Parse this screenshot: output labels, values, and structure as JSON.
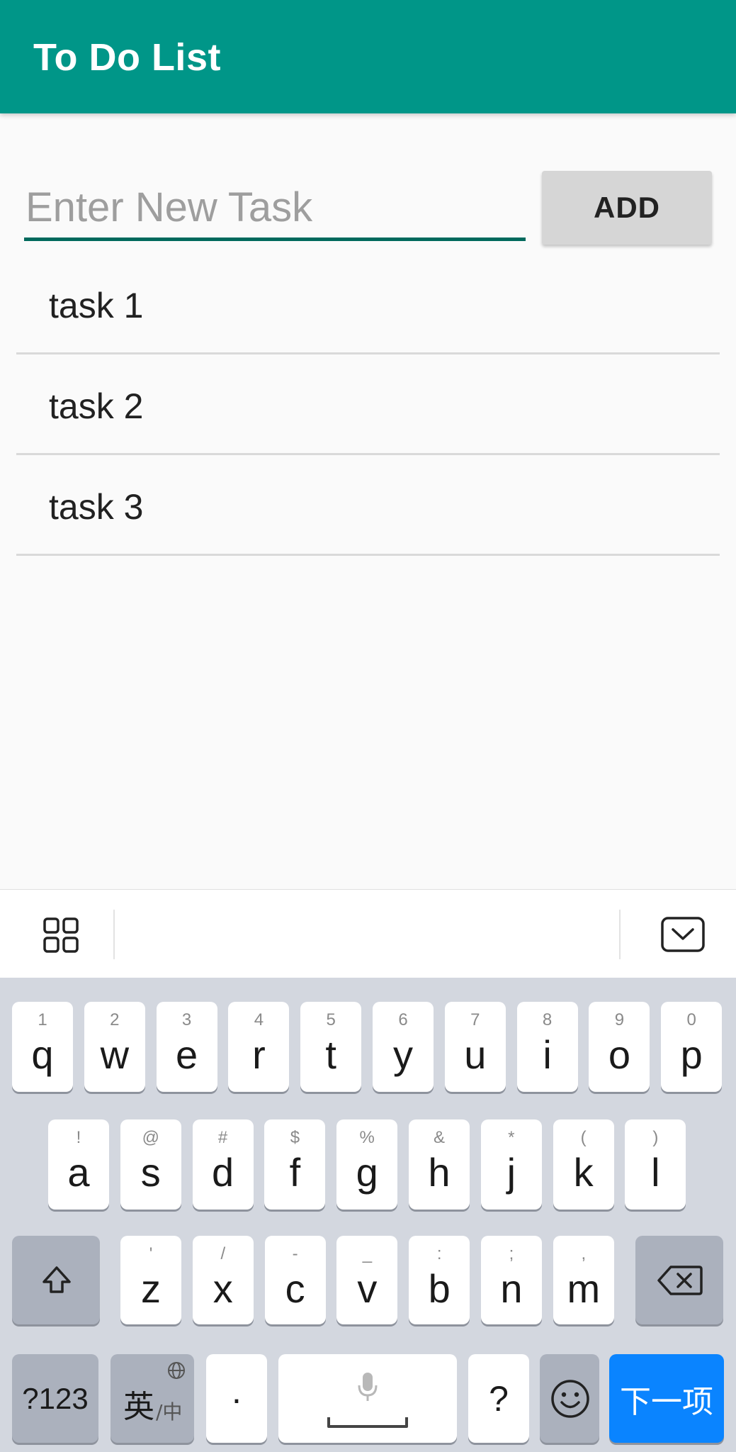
{
  "app": {
    "title": "To Do List"
  },
  "input": {
    "placeholder": "Enter New Task",
    "value": ""
  },
  "add_button": {
    "label": "ADD"
  },
  "tasks": [
    {
      "label": "task 1"
    },
    {
      "label": "task 2"
    },
    {
      "label": "task 3"
    }
  ],
  "colors": {
    "appbar": "#009688",
    "underline": "#00695c",
    "enter_key": "#0a84ff"
  },
  "keyboard": {
    "toolbar": {
      "left_icon": "grid-icon",
      "right_icon": "collapse-keyboard-icon"
    },
    "row1": [
      {
        "hint": "1",
        "key": "q"
      },
      {
        "hint": "2",
        "key": "w"
      },
      {
        "hint": "3",
        "key": "e"
      },
      {
        "hint": "4",
        "key": "r"
      },
      {
        "hint": "5",
        "key": "t"
      },
      {
        "hint": "6",
        "key": "y"
      },
      {
        "hint": "7",
        "key": "u"
      },
      {
        "hint": "8",
        "key": "i"
      },
      {
        "hint": "9",
        "key": "o"
      },
      {
        "hint": "0",
        "key": "p"
      }
    ],
    "row2": [
      {
        "hint": "!",
        "key": "a"
      },
      {
        "hint": "@",
        "key": "s"
      },
      {
        "hint": "#",
        "key": "d"
      },
      {
        "hint": "$",
        "key": "f"
      },
      {
        "hint": "%",
        "key": "g"
      },
      {
        "hint": "&",
        "key": "h"
      },
      {
        "hint": "*",
        "key": "j"
      },
      {
        "hint": "(",
        "key": "k"
      },
      {
        "hint": ")",
        "key": "l"
      }
    ],
    "row3": [
      {
        "hint": "'",
        "key": "z"
      },
      {
        "hint": "/",
        "key": "x"
      },
      {
        "hint": "-",
        "key": "c"
      },
      {
        "hint": "_",
        "key": "v"
      },
      {
        "hint": ":",
        "key": "b"
      },
      {
        "hint": ";",
        "key": "n"
      },
      {
        "hint": ",",
        "key": "m"
      }
    ],
    "symbols_key": "?123",
    "lang_key_main": "英",
    "lang_key_sub": "/中",
    "period_key": "·",
    "question_key": "?",
    "enter_key": "下一项"
  }
}
